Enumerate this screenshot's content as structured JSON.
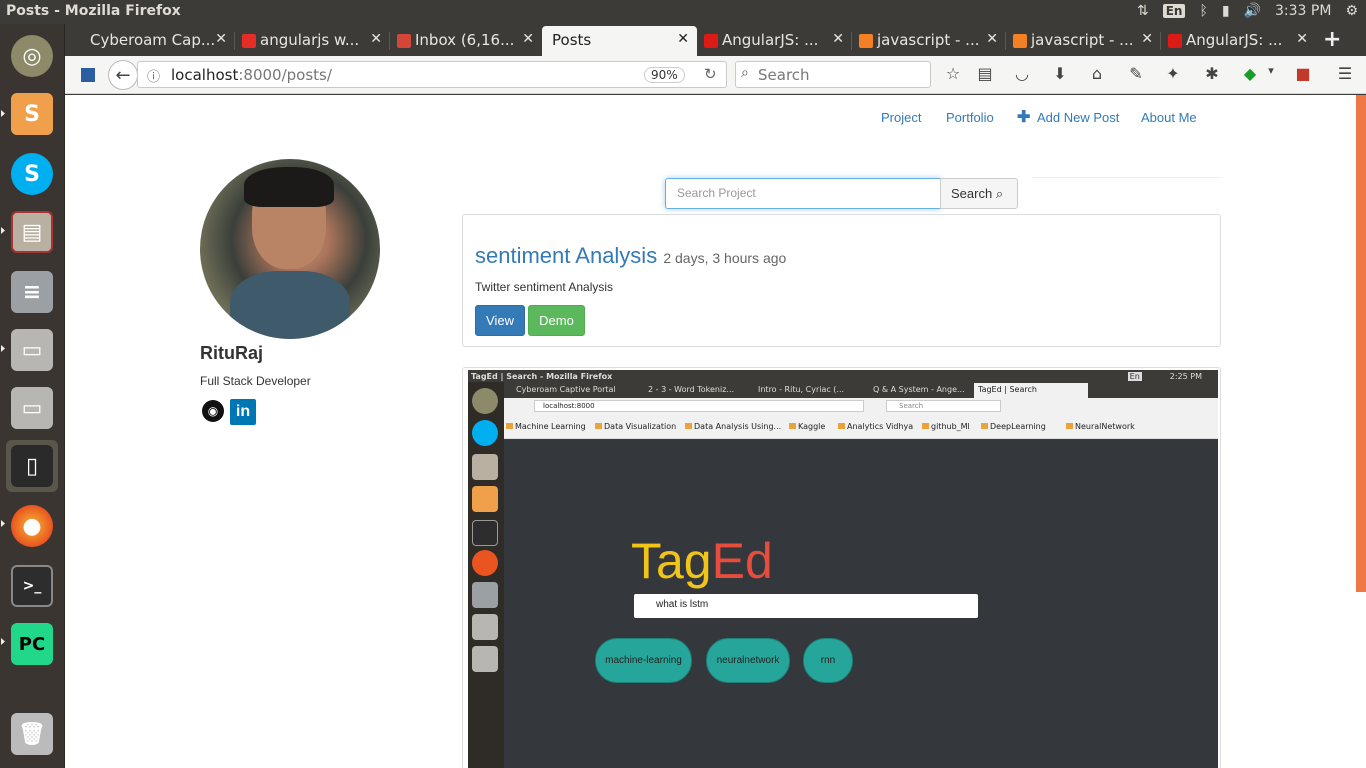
{
  "system": {
    "window_title": "Posts - Mozilla Firefox",
    "keyboard_layout": "En",
    "clock": "3:33 PM"
  },
  "launcher": {
    "items": [
      "ubuntu-icon",
      "sublime-text-icon",
      "skype-icon",
      "file-manager-icon",
      "database-icon",
      "drive-icon",
      "drive-icon-2",
      "phone-icon",
      "firefox-icon",
      "terminal-icon",
      "pycharm-icon",
      "trash-icon"
    ]
  },
  "tabs": [
    {
      "label": "Cyberoam Cap...",
      "favicon_color": "#3c3b37"
    },
    {
      "label": "angularjs w...",
      "favicon_color": "#e52d27"
    },
    {
      "label": "Inbox (6,16...",
      "favicon_color": "#d44638"
    },
    {
      "label": "Posts",
      "favicon_color": "#f5f5f4"
    },
    {
      "label": "AngularJS: ...",
      "favicon_color": "#dd1b16"
    },
    {
      "label": "javascript - ...",
      "favicon_color": "#f48024"
    },
    {
      "label": "javascript - ...",
      "favicon_color": "#f48024"
    },
    {
      "label": "AngularJS: ...",
      "favicon_color": "#dd1b16"
    }
  ],
  "navbar": {
    "url_host": "localhost",
    "url_rest": ":8000/posts/",
    "zoom": "90%",
    "search_placeholder": "Search"
  },
  "site": {
    "nav": {
      "project": "Project",
      "portfolio": "Portfolio",
      "add_post": "Add New Post",
      "about": "About Me"
    },
    "profile": {
      "name": "RituRaj",
      "role": "Full Stack Developer",
      "github_glyph": "◉",
      "linkedin_glyph": "in"
    },
    "search": {
      "placeholder": "Search Project",
      "button_label": "Search"
    },
    "post": {
      "title": "sentiment Analysis",
      "time": "2 days, 3 hours ago",
      "description": "Twitter sentiment Analysis",
      "view_label": "View",
      "demo_label": "Demo"
    }
  },
  "embedded": {
    "window_title": "TagEd | Search - Mozilla Firefox",
    "clock": "2:25 PM",
    "keyboard_layout": "En",
    "tabs": [
      "Cyberoam Captive Portal",
      "2 - 3 - Word Tokeniz...",
      "Intro - Ritu, Cyriac (...",
      "Q & A System - Ange...",
      "TagEd | Search"
    ],
    "url": "localhost:8000",
    "search_placeholder": "Search",
    "bookmarks": [
      "Machine Learning",
      "Data Visualization",
      "Data Analysis Using...",
      "Kaggle",
      "Analytics Vidhya",
      "github_Ml",
      "DeepLearning",
      "NeuralNetwork"
    ],
    "logo_part1": "Tag",
    "logo_part2": "Ed",
    "query": "what is lstm",
    "tags": [
      "machine-learning",
      "neuralnetwork",
      "rnn"
    ]
  }
}
